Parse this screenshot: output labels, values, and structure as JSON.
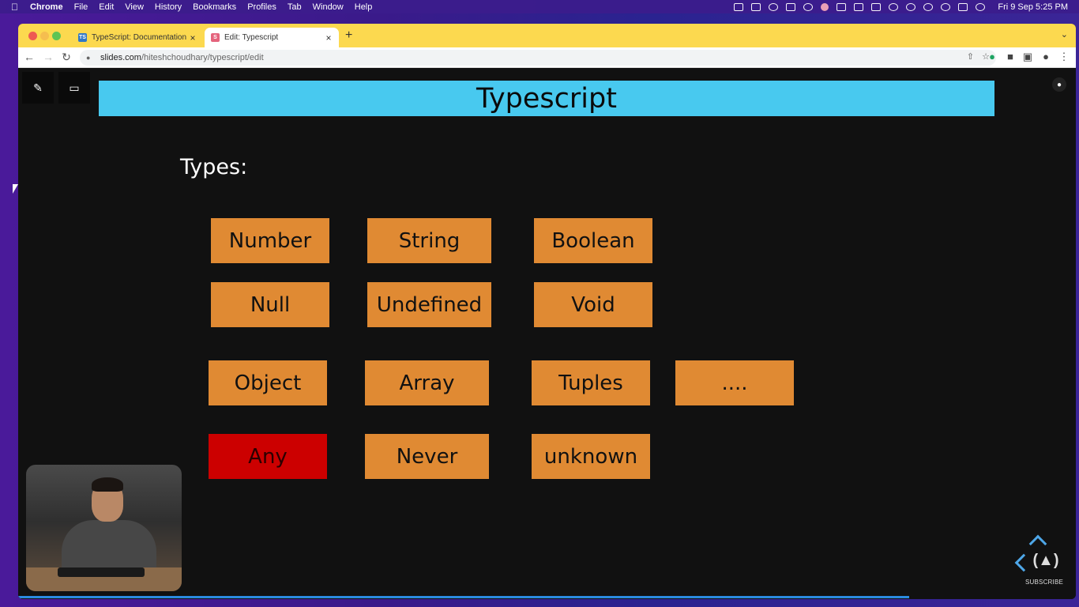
{
  "menubar": {
    "app": "Chrome",
    "items": [
      "File",
      "Edit",
      "View",
      "History",
      "Bookmarks",
      "Profiles",
      "Tab",
      "Window",
      "Help"
    ],
    "clock": "Fri 9 Sep  5:25 PM"
  },
  "browser": {
    "tabs": [
      {
        "title": "TypeScript: Documentation - T",
        "favicon": "TS"
      },
      {
        "title": "Edit: Typescript",
        "favicon": "S"
      }
    ],
    "url_host": "slides.com",
    "url_path": "/hiteshchoudhary/typescript/edit"
  },
  "slide": {
    "title": "Typescript",
    "subtitle": "Types:",
    "types": {
      "number": "Number",
      "string": "String",
      "boolean": "Boolean",
      "null": "Null",
      "undefined": "Undefined",
      "void": "Void",
      "object": "Object",
      "array": "Array",
      "tuples": "Tuples",
      "more": "....",
      "any": "Any",
      "never": "Never",
      "unknown": "unknown"
    },
    "highlight_color": "#cc0000",
    "box_color": "#e08a33",
    "title_bar_color": "#48c9ef"
  },
  "overlay": {
    "subscribe_label": "SUBSCRIBE"
  }
}
